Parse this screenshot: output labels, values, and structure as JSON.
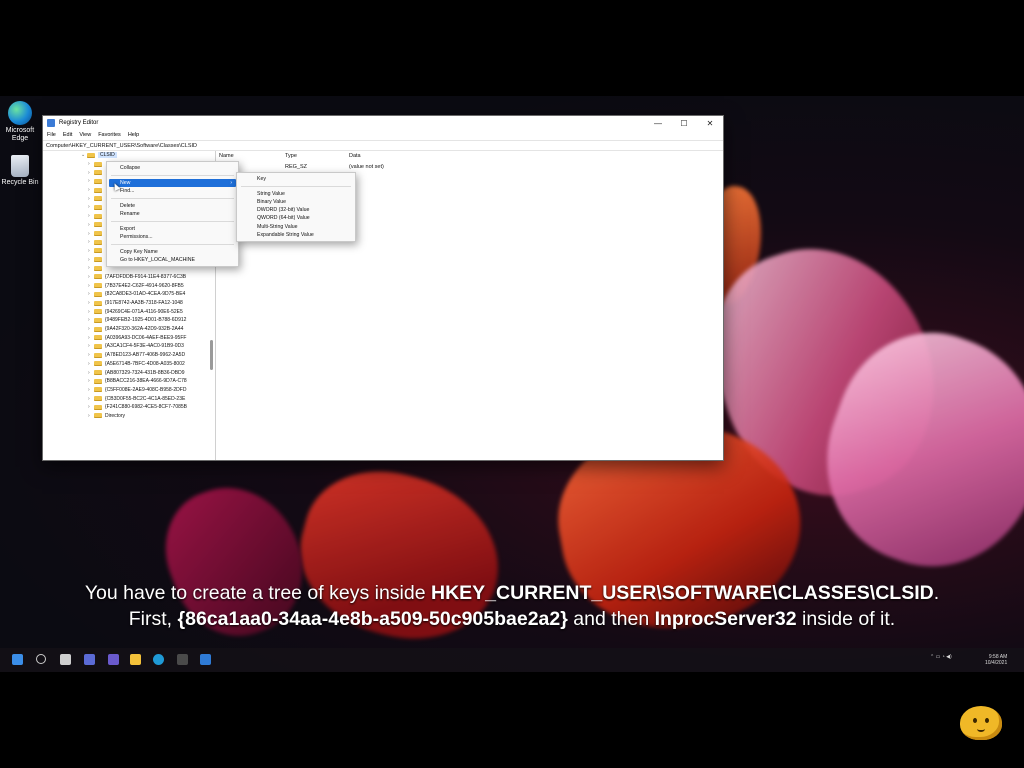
{
  "desktop": {
    "icons": [
      {
        "label": "Microsoft Edge",
        "icon": "edge-icon"
      },
      {
        "label": "Recycle Bin",
        "icon": "recycle-bin-icon"
      }
    ]
  },
  "window": {
    "title": "Registry Editor",
    "controls": {
      "minimize": "—",
      "maximize": "☐",
      "close": "✕"
    },
    "menu": [
      "File",
      "Edit",
      "View",
      "Favorites",
      "Help"
    ],
    "address": "Computer\\HKEY_CURRENT_USER\\Software\\Classes\\CLSID",
    "tree": {
      "selected": "CLSID",
      "rows": [
        "{7AFDFDDB-F914-11E4-8377-6C3B",
        "{7B37E4E2-C62F-4914-9620-8FB5",
        "{82CA8DE3-01AD-4CEA-9D75-BE4",
        "{917E8742-AA3B-7318-FA12-1048",
        "{94269C4E-071A-4116-90E6-52E5",
        "{9489FEB2-1925-4D01-B788-6D912",
        "{9A42F320-362A-42D9-932B-2A44",
        "{A0396A93-DC06-4AEF-BEE9-95FF",
        "{A3CA1CF4-5F3E-4AC0-91B9-0D3",
        "{A78ED123-AB77-406B-9962-2A5D",
        "{A5E6714B-7BFC-4D08-A035-8002",
        "{AB807329-7324-431B-8B36-DBD9",
        "{B8BACC216-38EA-4666-9D7A-C78",
        "{C5FF008E-2AE9-408C-B958-2DFD",
        "{CB3D0F55-BC2C-4C1A-85ED-23E",
        "{F241C880-6982-4CE5-8CF7-7085B",
        "Directory"
      ]
    },
    "values_pane": {
      "headers": {
        "name": "Name",
        "type": "Type",
        "data": "Data"
      },
      "row": {
        "type": "REG_SZ",
        "data": "(value not set)"
      }
    }
  },
  "context_menu": {
    "items": [
      "Collapse",
      "New",
      "Find...",
      "Delete",
      "Rename",
      "Export",
      "Permissions...",
      "Copy Key Name",
      "Go to HKEY_LOCAL_MACHINE"
    ],
    "highlighted": "New"
  },
  "submenu": {
    "items": [
      "Key",
      "String Value",
      "Binary Value",
      "DWORD (32-bit) Value",
      "QWORD (64-bit) Value",
      "Multi-String Value",
      "Expandable String Value"
    ]
  },
  "caption": {
    "line1_pre": "You have to create a tree of keys inside ",
    "line1_bold": "HKEY_CURRENT_USER\\SOFTWARE\\CLASSES\\CLSID",
    "line1_post": ".",
    "line2_pre": "First, ",
    "line2_bold1": "{86ca1aa0-34aa-4e8b-a509-50c905bae2a2}",
    "line2_mid": " and then ",
    "line2_bold2": "InprocServer32",
    "line2_post": " inside of it."
  },
  "taskbar": {
    "tray_time": "9:58 AM",
    "tray_date": "10/4/2021"
  },
  "colors": {
    "selection_blue": "#1e6fd9",
    "folder_yellow": "#f0c44a"
  }
}
